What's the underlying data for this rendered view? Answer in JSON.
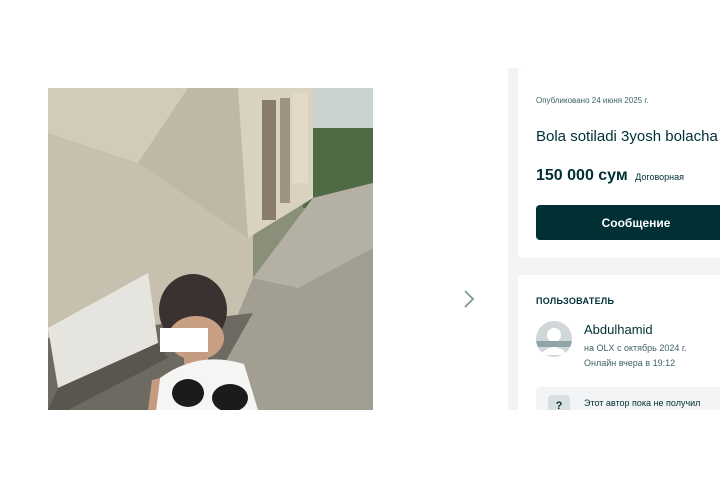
{
  "listing": {
    "published": "Опубликовано 24 июня 2025 г.",
    "title": "Bola sotiladi 3yosh bolacha",
    "price": "150 000 сум",
    "negotiable": "Договорная",
    "message_button": "Сообщение"
  },
  "gallery": {
    "next_icon": "chevron-right-icon"
  },
  "user": {
    "section_title": "ПОЛЬЗОВАТЕЛЬ",
    "name": "Abdulhamid",
    "member_since": "на OLX с октябрь 2024 г.",
    "last_online": "Онлайн вчера в 19:12",
    "avatar_icon": "user-avatar-icon",
    "notice_icon_glyph": "?",
    "notice_text": "Этот автор пока не получил"
  },
  "colors": {
    "primary": "#002f34",
    "background": "#f2f4f5",
    "muted_text": "#406367"
  }
}
